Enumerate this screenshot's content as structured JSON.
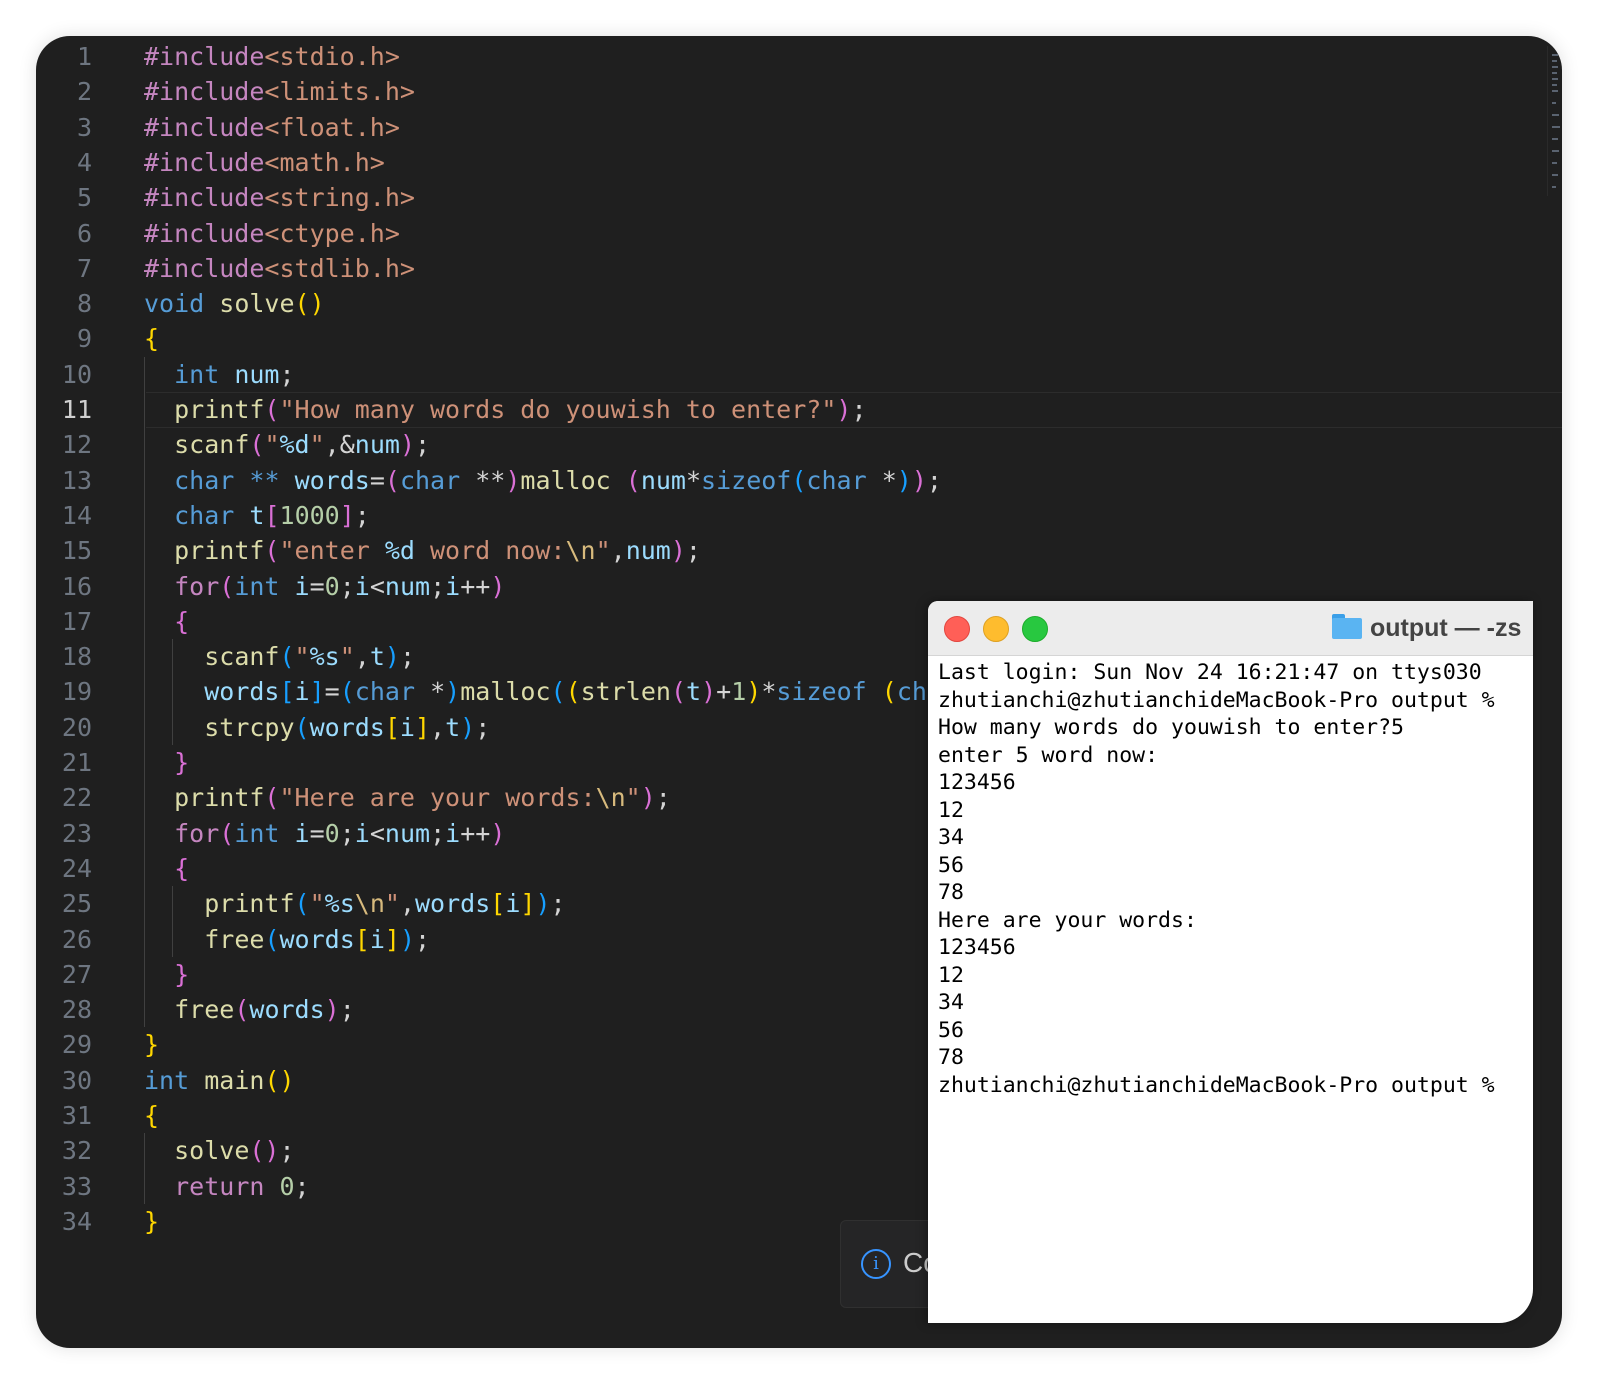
{
  "colors": {
    "editor_bg": "#1f1f1f",
    "line_number": "#6e7681",
    "line_number_active": "#d0d0d0",
    "preprocessor": "#c586c0",
    "include_path": "#ce9178",
    "keyword": "#569cd6",
    "control": "#c586c0",
    "function": "#dcdcaa",
    "variable": "#9cdcfe",
    "string": "#ce9178",
    "escape": "#d7ba7d",
    "number": "#b5cea8",
    "punct": "#d4d4d4",
    "bracket1": "#ffd700",
    "bracket2": "#da70d6",
    "bracket3": "#179fff",
    "terminal_bg": "#ffffff",
    "terminal_text": "#000000",
    "traffic_close": "#ff5f57",
    "traffic_min": "#febc2e",
    "traffic_max": "#28c840"
  },
  "editor": {
    "current_line": 11,
    "lines": [
      {
        "n": "1",
        "tokens": [
          [
            "#include",
            "preprocessor"
          ],
          [
            "<stdio.h>",
            "include_path"
          ]
        ]
      },
      {
        "n": "2",
        "tokens": [
          [
            "#include",
            "preprocessor"
          ],
          [
            "<limits.h>",
            "include_path"
          ]
        ]
      },
      {
        "n": "3",
        "tokens": [
          [
            "#include",
            "preprocessor"
          ],
          [
            "<float.h>",
            "include_path"
          ]
        ]
      },
      {
        "n": "4",
        "tokens": [
          [
            "#include",
            "preprocessor"
          ],
          [
            "<math.h>",
            "include_path"
          ]
        ]
      },
      {
        "n": "5",
        "tokens": [
          [
            "#include",
            "preprocessor"
          ],
          [
            "<string.h>",
            "include_path"
          ]
        ]
      },
      {
        "n": "6",
        "tokens": [
          [
            "#include",
            "preprocessor"
          ],
          [
            "<ctype.h>",
            "include_path"
          ]
        ]
      },
      {
        "n": "7",
        "tokens": [
          [
            "#include",
            "preprocessor"
          ],
          [
            "<stdlib.h>",
            "include_path"
          ]
        ]
      },
      {
        "n": "8",
        "tokens": [
          [
            "void",
            "keyword"
          ],
          [
            " ",
            "punct"
          ],
          [
            "solve",
            "function"
          ],
          [
            "()",
            "bracket1"
          ]
        ]
      },
      {
        "n": "9",
        "tokens": [
          [
            "{",
            "bracket1"
          ]
        ]
      },
      {
        "n": "10",
        "tokens": [
          [
            "  ",
            "punct"
          ],
          [
            "int",
            "keyword"
          ],
          [
            " ",
            "punct"
          ],
          [
            "num",
            "variable"
          ],
          [
            ";",
            "punct"
          ]
        ]
      },
      {
        "n": "11",
        "tokens": [
          [
            "  ",
            "punct"
          ],
          [
            "printf",
            "function"
          ],
          [
            "(",
            "bracket2"
          ],
          [
            "\"How many words do youwish to enter?\"",
            "string"
          ],
          [
            ")",
            "bracket2"
          ],
          [
            ";",
            "punct"
          ]
        ]
      },
      {
        "n": "12",
        "tokens": [
          [
            "  ",
            "punct"
          ],
          [
            "scanf",
            "function"
          ],
          [
            "(",
            "bracket2"
          ],
          [
            "\"",
            "string"
          ],
          [
            "%d",
            "variable"
          ],
          [
            "\"",
            "string"
          ],
          [
            ",&",
            "punct"
          ],
          [
            "num",
            "variable"
          ],
          [
            ")",
            "bracket2"
          ],
          [
            ";",
            "punct"
          ]
        ]
      },
      {
        "n": "13",
        "tokens": [
          [
            "  ",
            "punct"
          ],
          [
            "char",
            "keyword"
          ],
          [
            " ",
            "punct"
          ],
          [
            "**",
            "keyword"
          ],
          [
            " ",
            "punct"
          ],
          [
            "words",
            "variable"
          ],
          [
            "=",
            "punct"
          ],
          [
            "(",
            "bracket2"
          ],
          [
            "char",
            "keyword"
          ],
          [
            " **",
            "punct"
          ],
          [
            ")",
            "bracket2"
          ],
          [
            "malloc",
            "function"
          ],
          [
            " ",
            "punct"
          ],
          [
            "(",
            "bracket2"
          ],
          [
            "num",
            "variable"
          ],
          [
            "*",
            "punct"
          ],
          [
            "sizeof",
            "keyword"
          ],
          [
            "(",
            "bracket3"
          ],
          [
            "char",
            "keyword"
          ],
          [
            " *",
            "punct"
          ],
          [
            ")",
            "bracket3"
          ],
          [
            ")",
            "bracket2"
          ],
          [
            ";",
            "punct"
          ]
        ]
      },
      {
        "n": "14",
        "tokens": [
          [
            "  ",
            "punct"
          ],
          [
            "char",
            "keyword"
          ],
          [
            " ",
            "punct"
          ],
          [
            "t",
            "variable"
          ],
          [
            "[",
            "bracket2"
          ],
          [
            "1000",
            "number"
          ],
          [
            "]",
            "bracket2"
          ],
          [
            ";",
            "punct"
          ]
        ]
      },
      {
        "n": "15",
        "tokens": [
          [
            "  ",
            "punct"
          ],
          [
            "printf",
            "function"
          ],
          [
            "(",
            "bracket2"
          ],
          [
            "\"enter ",
            "string"
          ],
          [
            "%d",
            "variable"
          ],
          [
            " word now:",
            "string"
          ],
          [
            "\\n",
            "escape"
          ],
          [
            "\"",
            "string"
          ],
          [
            ",",
            "punct"
          ],
          [
            "num",
            "variable"
          ],
          [
            ")",
            "bracket2"
          ],
          [
            ";",
            "punct"
          ]
        ]
      },
      {
        "n": "16",
        "tokens": [
          [
            "  ",
            "punct"
          ],
          [
            "for",
            "control"
          ],
          [
            "(",
            "bracket2"
          ],
          [
            "int",
            "keyword"
          ],
          [
            " ",
            "punct"
          ],
          [
            "i",
            "variable"
          ],
          [
            "=",
            "punct"
          ],
          [
            "0",
            "number"
          ],
          [
            ";",
            "punct"
          ],
          [
            "i",
            "variable"
          ],
          [
            "<",
            "punct"
          ],
          [
            "num",
            "variable"
          ],
          [
            ";",
            "punct"
          ],
          [
            "i",
            "variable"
          ],
          [
            "++",
            "punct"
          ],
          [
            ")",
            "bracket2"
          ]
        ]
      },
      {
        "n": "17",
        "tokens": [
          [
            "  ",
            "punct"
          ],
          [
            "{",
            "bracket2"
          ]
        ]
      },
      {
        "n": "18",
        "tokens": [
          [
            "    ",
            "punct"
          ],
          [
            "scanf",
            "function"
          ],
          [
            "(",
            "bracket3"
          ],
          [
            "\"",
            "string"
          ],
          [
            "%s",
            "variable"
          ],
          [
            "\"",
            "string"
          ],
          [
            ",",
            "punct"
          ],
          [
            "t",
            "variable"
          ],
          [
            ")",
            "bracket3"
          ],
          [
            ";",
            "punct"
          ]
        ]
      },
      {
        "n": "19",
        "tokens": [
          [
            "    ",
            "punct"
          ],
          [
            "words",
            "variable"
          ],
          [
            "[",
            "bracket3"
          ],
          [
            "i",
            "variable"
          ],
          [
            "]",
            "bracket3"
          ],
          [
            "=",
            "punct"
          ],
          [
            "(",
            "bracket3"
          ],
          [
            "char",
            "keyword"
          ],
          [
            " *",
            "punct"
          ],
          [
            ")",
            "bracket3"
          ],
          [
            "malloc",
            "function"
          ],
          [
            "(",
            "bracket3"
          ],
          [
            "(",
            "bracket1"
          ],
          [
            "strlen",
            "function"
          ],
          [
            "(",
            "bracket2"
          ],
          [
            "t",
            "variable"
          ],
          [
            ")",
            "bracket2"
          ],
          [
            "+",
            "punct"
          ],
          [
            "1",
            "number"
          ],
          [
            ")",
            "bracket1"
          ],
          [
            "*",
            "punct"
          ],
          [
            "sizeof",
            "keyword"
          ],
          [
            " ",
            "punct"
          ],
          [
            "(",
            "bracket1"
          ],
          [
            "char",
            "keyword"
          ],
          [
            ")",
            "bracket1"
          ]
        ]
      },
      {
        "n": "20",
        "tokens": [
          [
            "    ",
            "punct"
          ],
          [
            "strcpy",
            "function"
          ],
          [
            "(",
            "bracket3"
          ],
          [
            "words",
            "variable"
          ],
          [
            "[",
            "bracket1"
          ],
          [
            "i",
            "variable"
          ],
          [
            "]",
            "bracket1"
          ],
          [
            ",",
            "punct"
          ],
          [
            "t",
            "variable"
          ],
          [
            ")",
            "bracket3"
          ],
          [
            ";",
            "punct"
          ]
        ]
      },
      {
        "n": "21",
        "tokens": [
          [
            "  ",
            "punct"
          ],
          [
            "}",
            "bracket2"
          ]
        ]
      },
      {
        "n": "22",
        "tokens": [
          [
            "  ",
            "punct"
          ],
          [
            "printf",
            "function"
          ],
          [
            "(",
            "bracket2"
          ],
          [
            "\"Here are your words:",
            "string"
          ],
          [
            "\\n",
            "escape"
          ],
          [
            "\"",
            "string"
          ],
          [
            ")",
            "bracket2"
          ],
          [
            ";",
            "punct"
          ]
        ]
      },
      {
        "n": "23",
        "tokens": [
          [
            "  ",
            "punct"
          ],
          [
            "for",
            "control"
          ],
          [
            "(",
            "bracket2"
          ],
          [
            "int",
            "keyword"
          ],
          [
            " ",
            "punct"
          ],
          [
            "i",
            "variable"
          ],
          [
            "=",
            "punct"
          ],
          [
            "0",
            "number"
          ],
          [
            ";",
            "punct"
          ],
          [
            "i",
            "variable"
          ],
          [
            "<",
            "punct"
          ],
          [
            "num",
            "variable"
          ],
          [
            ";",
            "punct"
          ],
          [
            "i",
            "variable"
          ],
          [
            "++",
            "punct"
          ],
          [
            ")",
            "bracket2"
          ]
        ]
      },
      {
        "n": "24",
        "tokens": [
          [
            "  ",
            "punct"
          ],
          [
            "{",
            "bracket2"
          ]
        ]
      },
      {
        "n": "25",
        "tokens": [
          [
            "    ",
            "punct"
          ],
          [
            "printf",
            "function"
          ],
          [
            "(",
            "bracket3"
          ],
          [
            "\"",
            "string"
          ],
          [
            "%s",
            "variable"
          ],
          [
            "\\n",
            "escape"
          ],
          [
            "\"",
            "string"
          ],
          [
            ",",
            "punct"
          ],
          [
            "words",
            "variable"
          ],
          [
            "[",
            "bracket1"
          ],
          [
            "i",
            "variable"
          ],
          [
            "]",
            "bracket1"
          ],
          [
            ")",
            "bracket3"
          ],
          [
            ";",
            "punct"
          ]
        ]
      },
      {
        "n": "26",
        "tokens": [
          [
            "    ",
            "punct"
          ],
          [
            "free",
            "function"
          ],
          [
            "(",
            "bracket3"
          ],
          [
            "words",
            "variable"
          ],
          [
            "[",
            "bracket1"
          ],
          [
            "i",
            "variable"
          ],
          [
            "]",
            "bracket1"
          ],
          [
            ")",
            "bracket3"
          ],
          [
            ";",
            "punct"
          ]
        ]
      },
      {
        "n": "27",
        "tokens": [
          [
            "  ",
            "punct"
          ],
          [
            "}",
            "bracket2"
          ]
        ]
      },
      {
        "n": "28",
        "tokens": [
          [
            "  ",
            "punct"
          ],
          [
            "free",
            "function"
          ],
          [
            "(",
            "bracket2"
          ],
          [
            "words",
            "variable"
          ],
          [
            ")",
            "bracket2"
          ],
          [
            ";",
            "punct"
          ]
        ]
      },
      {
        "n": "29",
        "tokens": [
          [
            "}",
            "bracket1"
          ]
        ]
      },
      {
        "n": "30",
        "tokens": [
          [
            "int",
            "keyword"
          ],
          [
            " ",
            "punct"
          ],
          [
            "main",
            "function"
          ],
          [
            "()",
            "bracket1"
          ]
        ]
      },
      {
        "n": "31",
        "tokens": [
          [
            "{",
            "bracket1"
          ]
        ]
      },
      {
        "n": "32",
        "tokens": [
          [
            "  ",
            "punct"
          ],
          [
            "solve",
            "function"
          ],
          [
            "()",
            "bracket2"
          ],
          [
            ";",
            "punct"
          ]
        ]
      },
      {
        "n": "33",
        "tokens": [
          [
            "  ",
            "punct"
          ],
          [
            "return",
            "control"
          ],
          [
            " ",
            "punct"
          ],
          [
            "0",
            "number"
          ],
          [
            ";",
            "punct"
          ]
        ]
      },
      {
        "n": "34",
        "tokens": [
          [
            "}",
            "bracket1"
          ]
        ]
      }
    ]
  },
  "notification": {
    "icon": "info-icon",
    "text": "Co"
  },
  "terminal": {
    "title": "output — -zs",
    "folder_icon": "folder-icon",
    "lines": [
      "Last login: Sun Nov 24 16:21:47 on ttys030",
      "zhutianchi@zhutianchideMacBook-Pro output %",
      "How many words do youwish to enter?5",
      "enter 5 word now:",
      "123456",
      "12",
      "34",
      "56",
      "78",
      "Here are your words:",
      "123456",
      "12",
      "34",
      "56",
      "78",
      "zhutianchi@zhutianchideMacBook-Pro output %"
    ]
  }
}
